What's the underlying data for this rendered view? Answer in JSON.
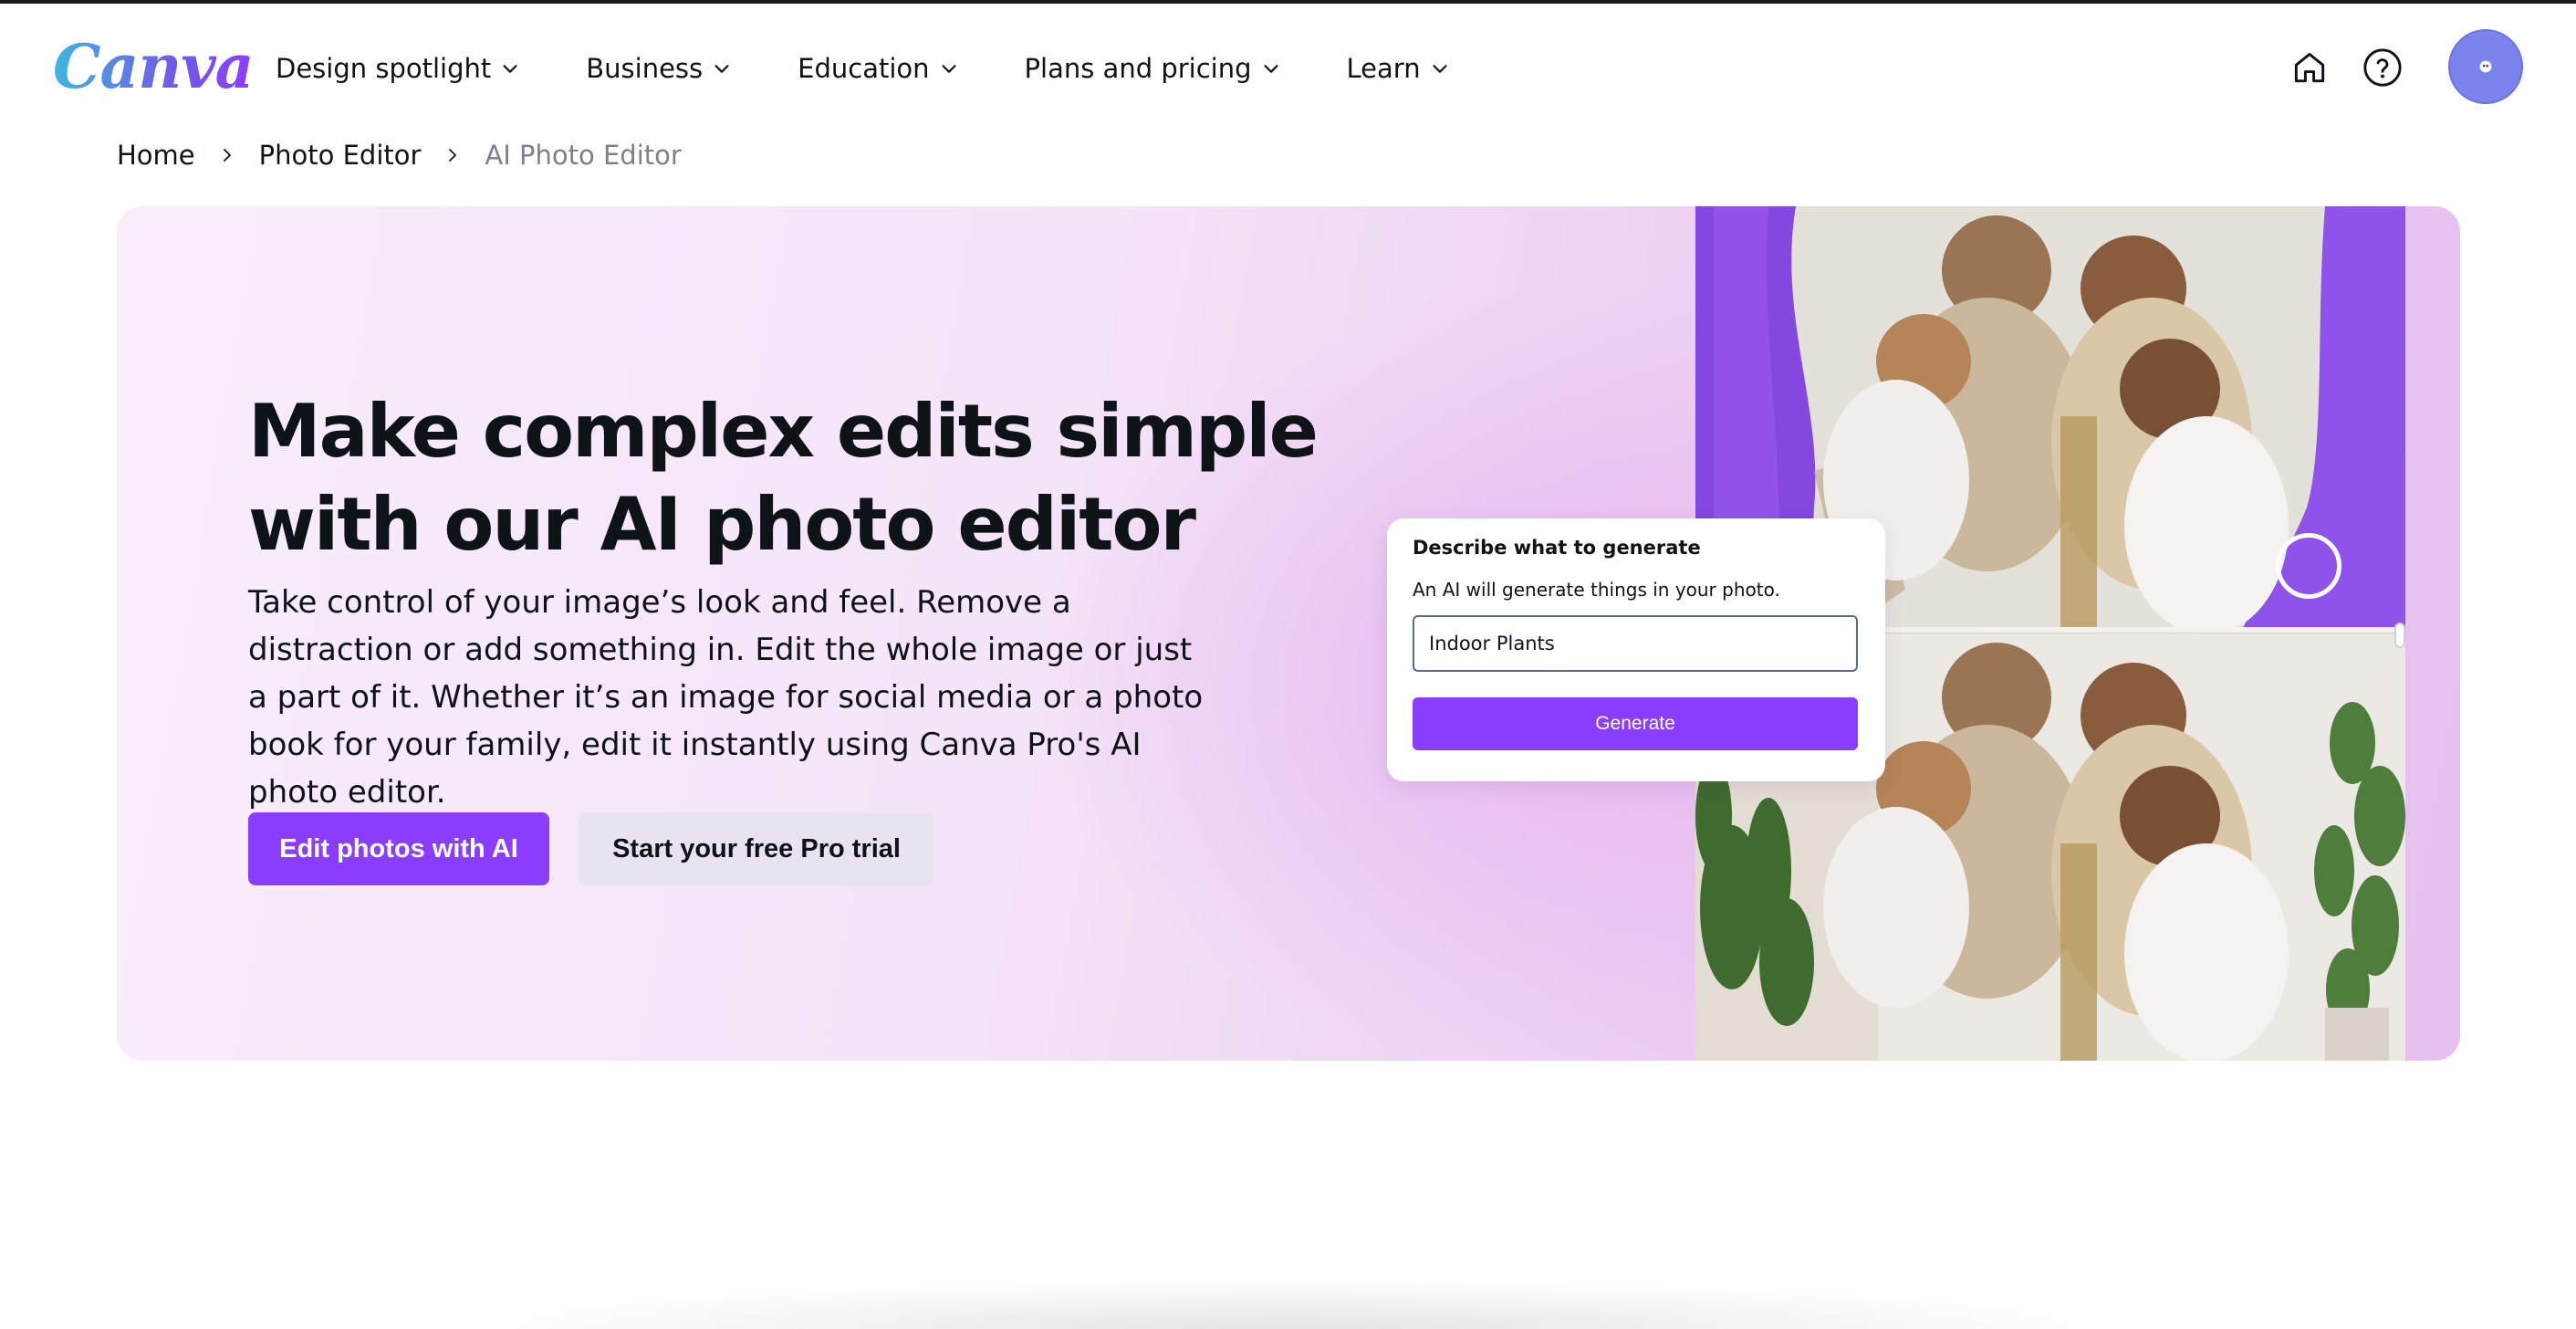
{
  "brand": {
    "logo_text": "Canva"
  },
  "nav": {
    "items": [
      {
        "label": "Design spotlight"
      },
      {
        "label": "Business"
      },
      {
        "label": "Education"
      },
      {
        "label": "Plans and pricing"
      },
      {
        "label": "Learn"
      }
    ]
  },
  "header_icons": {
    "home": "home-icon",
    "help": "help-icon",
    "avatar": "avatar"
  },
  "breadcrumb": {
    "items": [
      {
        "label": "Home"
      },
      {
        "label": "Photo Editor"
      },
      {
        "label": "AI Photo Editor"
      }
    ]
  },
  "hero": {
    "title": "Make complex edits simple with our AI photo editor",
    "description": "Take control of your image’s look and feel. Remove a distraction or add something in. Edit the whole image or just a part of it. Whether it’s an image for social media or a photo book for your family, edit it instantly using Canva Pro's AI photo editor.",
    "primary_button": "Edit photos with AI",
    "secondary_button": "Start your free Pro trial"
  },
  "generate_card": {
    "title": "Describe what to generate",
    "subtitle": "An AI will generate things in your photo.",
    "input_value": "Indoor Plants",
    "button_label": "Generate"
  },
  "colors": {
    "accent": "#8b3dff",
    "hero_bg_start": "#f8eefb",
    "hero_bg_end": "#e6c0f0",
    "avatar": "#7b83ec",
    "text": "#0e1318",
    "muted_text": "#7c818a"
  }
}
